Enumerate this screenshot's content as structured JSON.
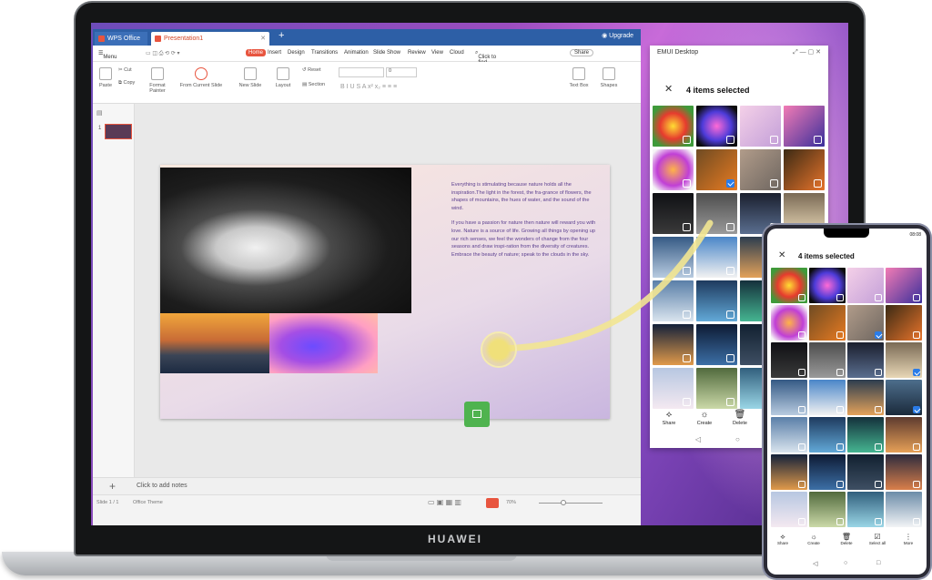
{
  "laptop": {
    "brand": "HUAWEI"
  },
  "wps": {
    "tabs": [
      {
        "label": "WPS Office"
      },
      {
        "label": "Presentation1"
      }
    ],
    "upgrade_label": "Upgrade",
    "menu": {
      "menu_label": "Menu",
      "items": [
        "Home",
        "Insert",
        "Design",
        "Transitions",
        "Animation",
        "Slide Show",
        "Review",
        "View",
        "Cloud"
      ],
      "search": "Click to find commands",
      "share": "Share"
    },
    "ribbon": {
      "paste": "Paste",
      "cut": "Cut",
      "copy": "Copy",
      "format_painter": "Format Painter",
      "from_current_slide": "From Current Slide",
      "new_slide": "New Slide",
      "layout": "Layout",
      "reset": "Reset",
      "section": "Section",
      "font_size": "0",
      "text_box": "Text Box",
      "shapes": "Shapes"
    },
    "slide_text": [
      "Everything is stimulating because nature holds all the inspiration.The light in the forest, the fra-grance of flowers, the shapes of mountains, the hues of water, and the sound of the wind.",
      "If you have a passion for nature then nature will reward you with love. Nature is a source of life. Growing all things by opening up our rich senses, we feel the wonders of change from the four seasons and draw inspi-ration from the diversity of creatures. Embrace the beauty of nature; speak to the clouds in the sky."
    ],
    "thumb_number": "1",
    "notes_placeholder": "Click to add notes",
    "status": {
      "slide": "Slide 1 / 1",
      "theme": "Office Theme",
      "zoom": "70%"
    }
  },
  "emui_window": {
    "title": "EMUI Desktop",
    "selection_title": "4 items selected",
    "actions": [
      "Share",
      "Create",
      "Delete"
    ]
  },
  "phone": {
    "time": "08:08",
    "selection_title": "4 items selected",
    "actions": [
      "Share",
      "Create",
      "Delete",
      "Select all",
      "More"
    ]
  },
  "colors": {
    "accent": "#e8553f",
    "check": "#2a7ce8",
    "drag": "#4fb34f",
    "arc": "#f2e691"
  },
  "icons": [
    "close-icon",
    "share-icon",
    "create-icon",
    "delete-icon",
    "back-icon",
    "home-icon",
    "image-icon",
    "plus-icon",
    "play-icon"
  ],
  "gallery_desktop_checked": [
    5,
    11,
    15
  ],
  "gallery_phone_checked": [
    6,
    11,
    15
  ]
}
